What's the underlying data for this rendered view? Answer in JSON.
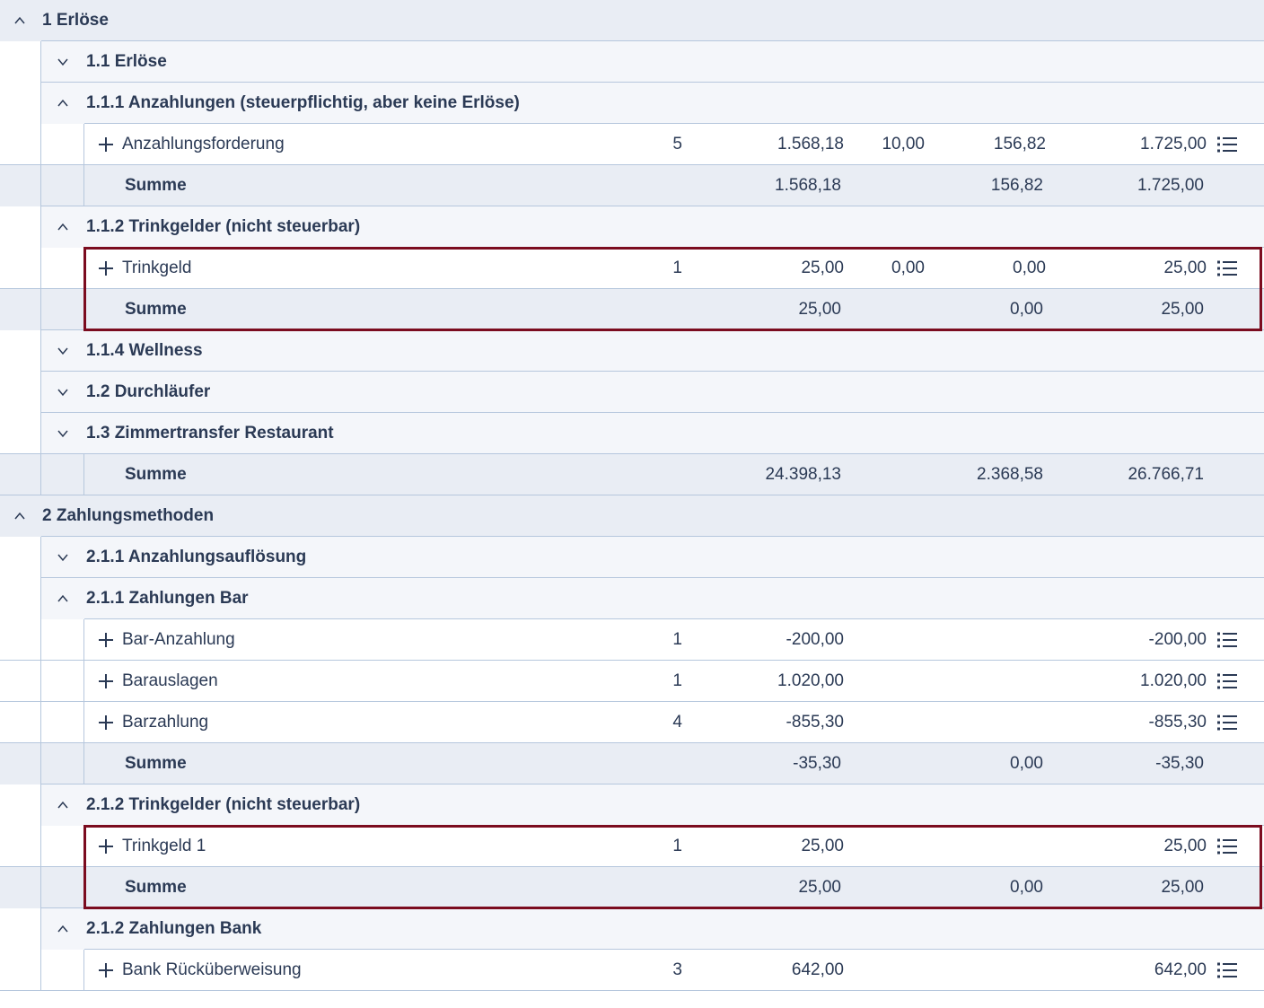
{
  "table": {
    "rows": [
      {
        "label": "1 Erlöse"
      },
      {
        "label": "1.1 Erlöse"
      },
      {
        "label": "1.1.1 Anzahlungen (steuerpflichtig, aber keine Erlöse)"
      },
      {
        "label": "Anzahlungsforderung",
        "count": "5",
        "net": "1.568,18",
        "rate": "10,00",
        "tax": "156,82",
        "gross": "1.725,00"
      },
      {
        "label": "Summe",
        "net": "1.568,18",
        "tax": "156,82",
        "gross": "1.725,00"
      },
      {
        "label": "1.1.2 Trinkgelder (nicht steuerbar)"
      },
      {
        "label": "Trinkgeld",
        "count": "1",
        "net": "25,00",
        "rate": "0,00",
        "tax": "0,00",
        "gross": "25,00"
      },
      {
        "label": "Summe",
        "net": "25,00",
        "tax": "0,00",
        "gross": "25,00"
      },
      {
        "label": "1.1.4 Wellness"
      },
      {
        "label": "1.2 Durchläufer"
      },
      {
        "label": "1.3 Zimmertransfer Restaurant"
      },
      {
        "label": "Summe",
        "net": "24.398,13",
        "tax": "2.368,58",
        "gross": "26.766,71"
      },
      {
        "label": "2 Zahlungsmethoden"
      },
      {
        "label": "2.1.1 Anzahlungsauflösung"
      },
      {
        "label": "2.1.1 Zahlungen Bar"
      },
      {
        "label": "Bar-Anzahlung",
        "count": "1",
        "net": "-200,00",
        "gross": "-200,00"
      },
      {
        "label": "Barauslagen",
        "count": "1",
        "net": "1.020,00",
        "gross": "1.020,00"
      },
      {
        "label": "Barzahlung",
        "count": "4",
        "net": "-855,30",
        "gross": "-855,30"
      },
      {
        "label": "Summe",
        "net": "-35,30",
        "tax": "0,00",
        "gross": "-35,30"
      },
      {
        "label": "2.1.2 Trinkgelder (nicht steuerbar)"
      },
      {
        "label": "Trinkgeld 1",
        "count": "1",
        "net": "25,00",
        "gross": "25,00"
      },
      {
        "label": "Summe",
        "net": "25,00",
        "tax": "0,00",
        "gross": "25,00"
      },
      {
        "label": "2.1.2 Zahlungen Bank"
      },
      {
        "label": "Bank Rücküberweisung",
        "count": "3",
        "net": "642,00",
        "gross": "642,00"
      }
    ]
  },
  "colors": {
    "row_grey": "#e9edf4",
    "row_light": "#f4f6fa",
    "grid_line": "#b6c7dd",
    "text": "#2b3a55",
    "highlight_border": "#7b0c1f"
  },
  "icons": {
    "expanded": "chevron-up-icon",
    "collapsed": "chevron-down-icon",
    "expand_item": "plus-icon",
    "details": "list-menu-icon"
  }
}
